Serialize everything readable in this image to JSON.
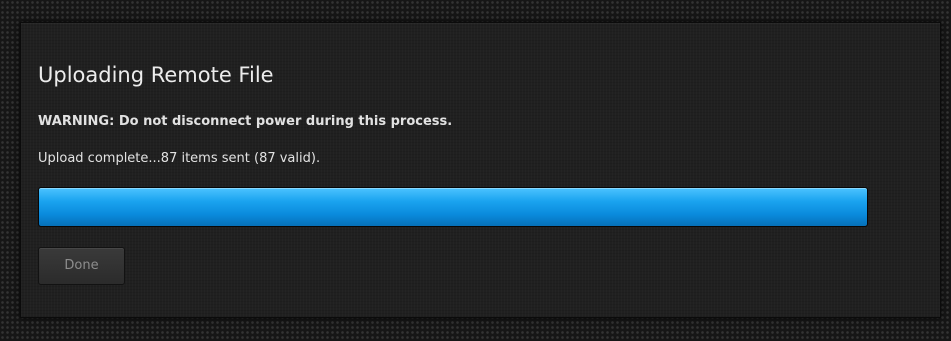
{
  "dialog": {
    "title": "Uploading Remote File",
    "warning": "WARNING: Do not disconnect power during this process.",
    "status": "Upload complete...87 items sent (87 valid).",
    "progress": {
      "fraction": 1.0,
      "color": "#1aa3ef"
    },
    "done_label": "Done"
  }
}
